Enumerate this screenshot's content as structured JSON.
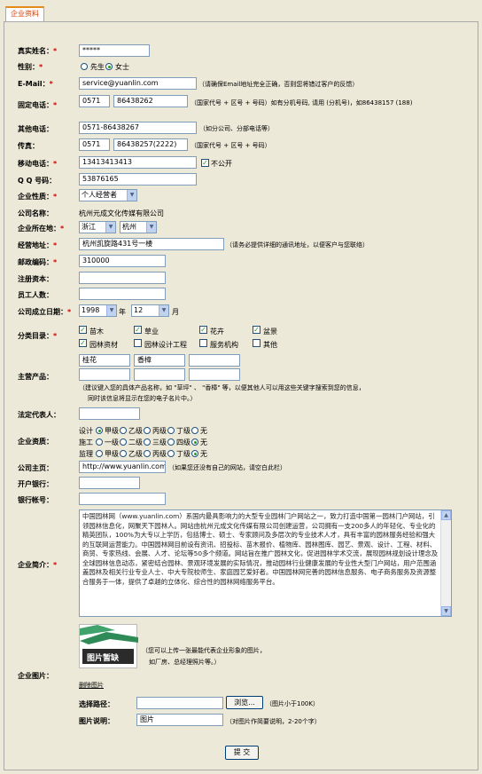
{
  "tab": {
    "label": "企业资料"
  },
  "fields": {
    "real_name": {
      "label": "真实姓名：",
      "value": "*****"
    },
    "gender": {
      "label": "性别：",
      "options": [
        "先生",
        "女士"
      ],
      "selected": "女士"
    },
    "email": {
      "label": "E-Mail：",
      "value": "service@yuanlin.com",
      "hint": "（请确保Email地址完全正确，否则您将错过客户的反馈）"
    },
    "phone": {
      "label": "固定电话：",
      "area": "0571",
      "number": "86438262",
      "hint": "（国家代号 + 区号 + 号码）如有分机号码, 请用 (分机号)，如86438157 (188)"
    },
    "other_phone": {
      "label": "其他电话：",
      "value": "0571-86438267",
      "hint": "（如分公司、分部电话等）"
    },
    "fax": {
      "label": "传真：",
      "area": "0571",
      "number": "86438257(2222)",
      "hint": "（国家代号 + 区号 + 号码）"
    },
    "mobile": {
      "label": "移动电话：",
      "value": "13413413413",
      "private_label": "不公开"
    },
    "qq": {
      "label": "Q Q 号码：",
      "value": "53876165"
    },
    "company_type": {
      "label": "企业性质：",
      "value": "个人经营者"
    },
    "company_name": {
      "label": "公司名称：",
      "value": "杭州元成文化传媒有限公司"
    },
    "location": {
      "label": "企业所在地：",
      "province": "浙江",
      "city": "杭州"
    },
    "address": {
      "label": "经营地址：",
      "value": "杭州凯旋路431号一楼",
      "hint": "（请务必提供详细的通讯地址，以便客户与您联络）"
    },
    "postcode": {
      "label": "邮政编码：",
      "value": "310000"
    },
    "capital": {
      "label": "注册资本：",
      "value": ""
    },
    "staff": {
      "label": "员工人数：",
      "value": ""
    },
    "founded": {
      "label": "公司成立日期：",
      "year": "1998",
      "year_unit": "年",
      "month": "12",
      "month_unit": "月"
    },
    "category": {
      "label": "分类目录：",
      "items": [
        {
          "label": "苗木",
          "checked": true
        },
        {
          "label": "草业",
          "checked": true
        },
        {
          "label": "花卉",
          "checked": true
        },
        {
          "label": "盆景",
          "checked": true
        },
        {
          "label": "园林资材",
          "checked": true
        },
        {
          "label": "园林设计工程",
          "checked": false
        },
        {
          "label": "服务机构",
          "checked": false
        },
        {
          "label": "其他",
          "checked": false
        }
      ]
    },
    "products": {
      "label": "主营产品：",
      "values": [
        "桂花",
        "香樟",
        "",
        "",
        "",
        ""
      ],
      "hint1": "（建议键入您的具体产品名称，如 \"草坪\" 、 \"香樟\" 等，以便其他人可以用这些关键字搜索到您的信息，",
      "hint2": "同时该信息将显示在您的电子名片中。）"
    },
    "legal_rep": {
      "label": "法定代表人：",
      "value": ""
    },
    "qualification": {
      "label": "企业资质：",
      "rows": [
        {
          "name": "设计",
          "options": [
            "甲级",
            "乙级",
            "丙级",
            "丁级",
            "无"
          ],
          "selected": "甲级"
        },
        {
          "name": "施工",
          "options": [
            "一级",
            "二级",
            "三级",
            "四级",
            "无"
          ],
          "selected": "无"
        },
        {
          "name": "监理",
          "options": [
            "甲级",
            "乙级",
            "丙级",
            "丁级",
            "无"
          ],
          "selected": "无"
        }
      ]
    },
    "homepage": {
      "label": "公司主页：",
      "value": "http://www.yuanlin.com",
      "hint": "（如果您还没有自己的网站，请空白此栏）"
    },
    "bank": {
      "label": "开户银行：",
      "value": ""
    },
    "account": {
      "label": "银行帐号：",
      "value": ""
    },
    "intro": {
      "label": "企业简介：",
      "text": "中国园林网（www.yuanlin.com）系国内最具影响力的大型专业园林门户网站之一，致力打造中国第一园林门户网站，引领园林信息化，网聚天下园林人。网站由杭州元成文化传媒有限公司创建运营，公司拥有一支200多人的年轻化、专业化的精英团队，100%为大专以上学历，包括博士、硕士、专家顾问及多层次的专业技术人才，具有丰富的园林服务经验和强大的互联网运营能力。中国园林网目前设有资讯、招投标、苗木报价、植物库、园林图库、园艺、景观、设计、工程、材料、商贸、专家热线、会展、人才、论坛等50多个频道。网站旨在推广园林文化，促进园林学术交流，展现园林规划设计理念及全球园林信息动态，紧密结合园林、景观环境发展的实际情况，推动园林行业健康发展的专业性大型门户网站，用户范围涵盖园林及相关行业专业人士、中大专院校师生、家庭园艺爱好者。中国园林网完善的园林信息服务、电子商务服务及资源整合服务于一体，提供了卓越的立体化、综合性的园林网络服务平台。"
    },
    "picture": {
      "label": "企业图片：",
      "placeholder_text": "图片暂缺",
      "hint1": "（您可以上传一张最能代表企业形象的图片，",
      "hint2": "如厂房、总经理照片等。）",
      "delete_label": "删除图片"
    },
    "upload": {
      "label": "选择路径：",
      "browse_label": "浏览...",
      "hint": "（图片小于100K）"
    },
    "pic_desc": {
      "label": "图片说明：",
      "value": "图片",
      "hint": "（对图片作简要说明，2-20个字）"
    }
  },
  "submit": {
    "label": "提 交"
  },
  "colors": {
    "background": "#ece9d8",
    "required": "#d00000",
    "tab_text": "#d03a00",
    "tab_border": "#e48a1b"
  }
}
